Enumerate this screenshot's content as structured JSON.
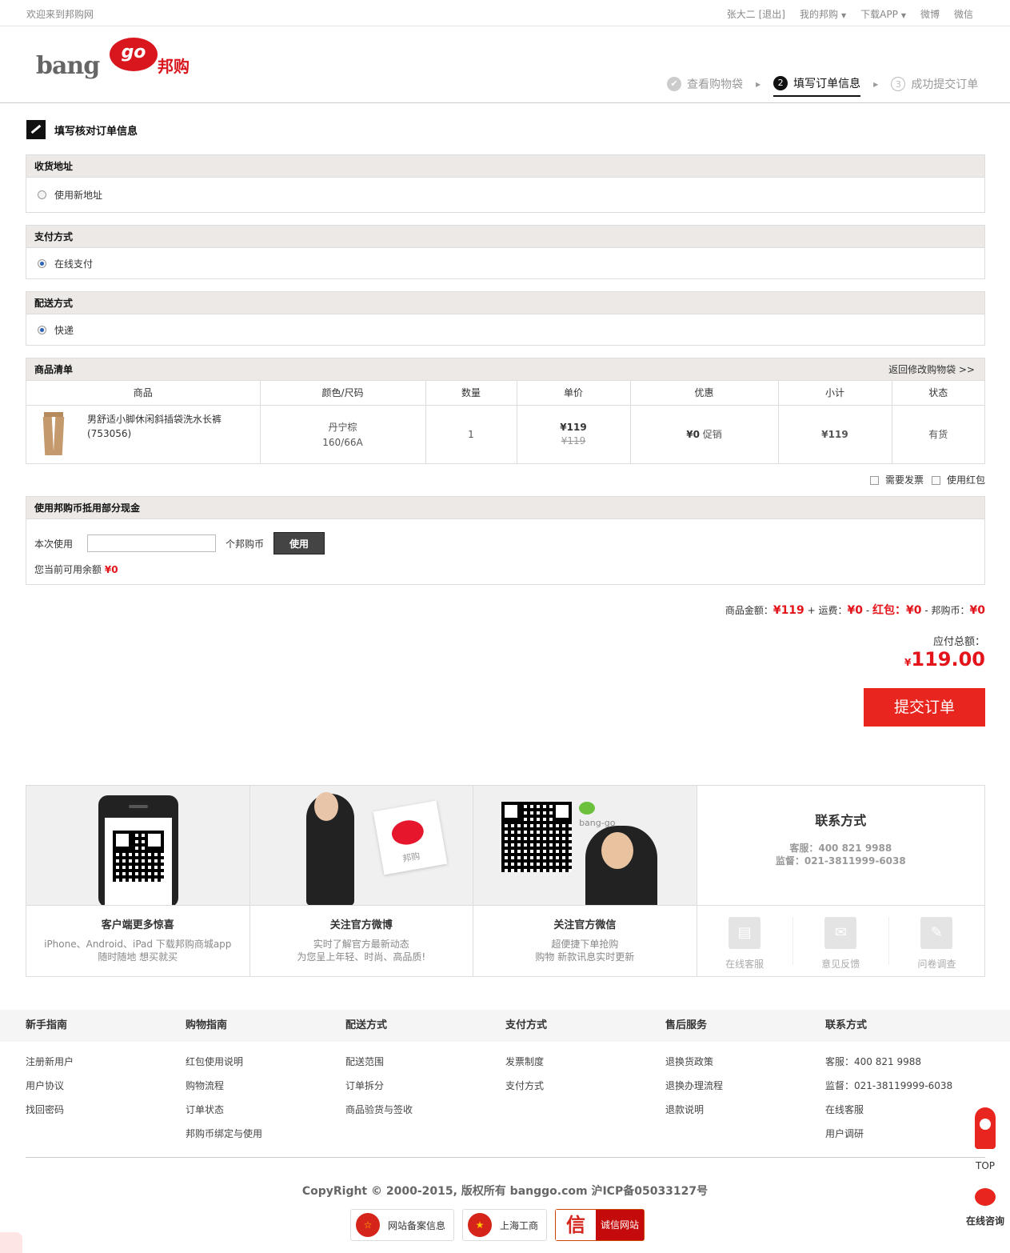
{
  "topbar": {
    "welcome": "欢迎来到邦购网",
    "user": "张大二 [退出]",
    "my_banggo": "我的邦购",
    "download_app": "下载APP",
    "weibo": "微博",
    "weixin": "微信"
  },
  "logo": {
    "bang": "bang",
    "go": "go",
    "cn": "邦购"
  },
  "steps": [
    {
      "num": "✔",
      "label": "查看购物袋",
      "state": "done"
    },
    {
      "num": "2",
      "label": "填写订单信息",
      "state": "active"
    },
    {
      "num": "3",
      "label": "成功提交订单",
      "state": "todo"
    }
  ],
  "page_title": "填写核对订单信息",
  "address": {
    "title": "收货地址",
    "option": "使用新地址"
  },
  "payment": {
    "title": "支付方式",
    "option": "在线支付"
  },
  "shipping": {
    "title": "配送方式",
    "option": "快递"
  },
  "items": {
    "title": "商品清单",
    "back_link": "返回修改购物袋 >>",
    "columns": [
      "商品",
      "颜色/尺码",
      "数量",
      "单价",
      "优惠",
      "小计",
      "状态"
    ],
    "rows": [
      {
        "name": "男舒适小脚休闲斜插袋洗水长裤 (753056)",
        "color": "丹宁棕",
        "size": "160/66A",
        "qty": "1",
        "price": "¥119",
        "orig_price": "¥119",
        "discount_amount": "¥0",
        "discount_label": "促销",
        "subtotal": "¥119",
        "status": "有货"
      }
    ]
  },
  "options": {
    "invoice": "需要发票",
    "redpacket": "使用红包"
  },
  "coins": {
    "title": "使用邦购币抵用部分现金",
    "use_label": "本次使用",
    "unit": "个邦购币",
    "button": "使用",
    "balance_label": "您当前可用余额",
    "balance": "¥0"
  },
  "summary": {
    "goods_label": "商品金额：",
    "goods": "¥119",
    "plus": "+",
    "freight_label": "运费：",
    "freight": "¥0",
    "minus1": "-",
    "redpacket_label": "红包：",
    "redpacket": "¥0",
    "minus2": "-",
    "coins_label": "邦购币：",
    "coins": "¥0",
    "payable_label": "应付总额：",
    "currency": "¥",
    "payable": "119.00"
  },
  "submit_button": "提交订单",
  "promo": [
    {
      "title": "客户端更多惊喜",
      "line1": "iPhone、Android、iPad 下载邦购商城app",
      "line2": "随时随地 想买就买"
    },
    {
      "title": "关注官方微博",
      "line1": "实时了解官方最新动态",
      "line2": "为您呈上年轻、时尚、高品质!"
    },
    {
      "title": "关注官方微信",
      "line1": "超便捷下单抢购",
      "line2": "购物 新款讯息实时更新"
    }
  ],
  "promo_image_text": {
    "weibo_card": "邦购",
    "wechat": "bang-go"
  },
  "contact": {
    "title": "联系方式",
    "service": "客服：400 821 9988",
    "supervise": "监督：021-3811999-6038",
    "icons": [
      "在线客服",
      "意见反馈",
      "问卷调查"
    ]
  },
  "footer": {
    "columns": [
      {
        "title": "新手指南",
        "links": [
          "注册新用户",
          "用户协议",
          "找回密码"
        ]
      },
      {
        "title": "购物指南",
        "links": [
          "红包使用说明",
          "购物流程",
          "订单状态",
          "邦购币绑定与使用"
        ]
      },
      {
        "title": "配送方式",
        "links": [
          "配送范围",
          "订单拆分",
          "商品验货与签收"
        ]
      },
      {
        "title": "支付方式",
        "links": [
          "发票制度",
          "支付方式"
        ]
      },
      {
        "title": "售后服务",
        "links": [
          "退换货政策",
          "退换办理流程",
          "退款说明"
        ]
      },
      {
        "title": "联系方式",
        "links": [
          "客服：400 821 9988",
          "监督：021-38119999-6038",
          "在线客服",
          "用户调研"
        ]
      }
    ],
    "copyright": "CopyRight © 2000-2015, 版权所有 banggo.com 沪ICP备05033127号",
    "badges": [
      "网站备案信息",
      "上海工商",
      "诚信网站"
    ],
    "badge_xin": "信"
  },
  "float": {
    "top": "TOP",
    "consult": "在线咨询"
  }
}
